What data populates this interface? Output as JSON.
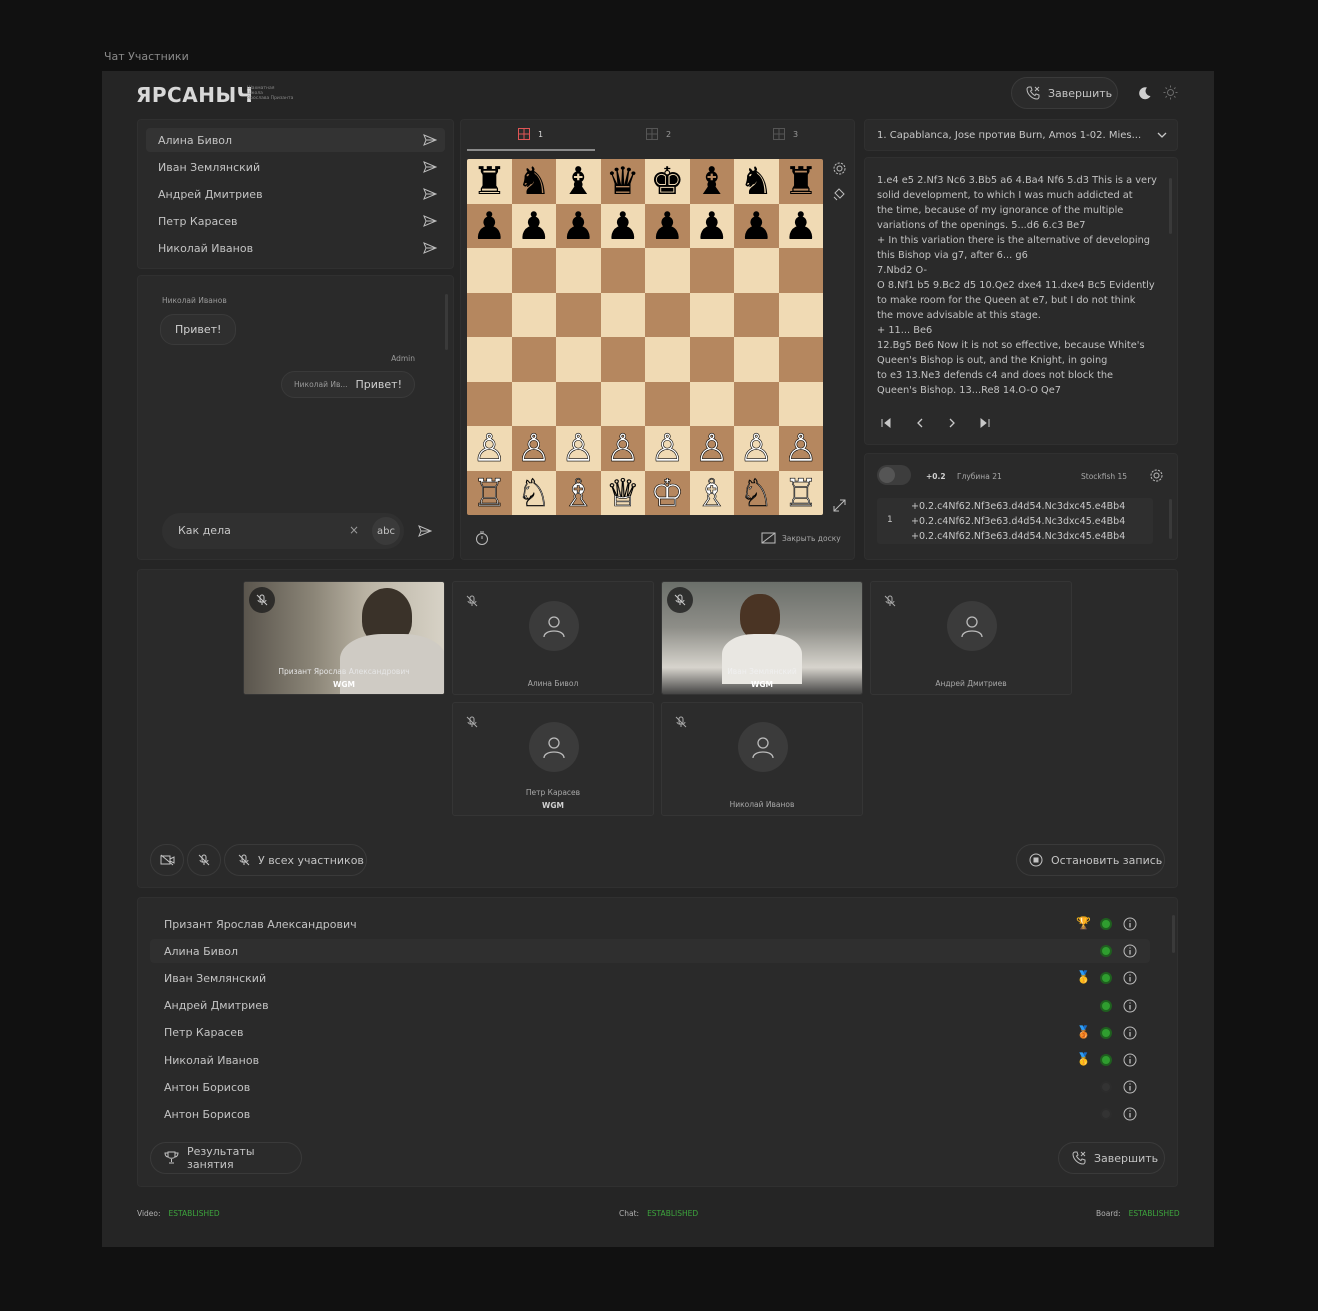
{
  "top_caption": "Чат Участники",
  "header": {
    "logo": "ЯРСАНЫЧ",
    "logo_sub": [
      "Шахматная",
      "Школа",
      "Ярослава Призанта"
    ],
    "end_button": "Завершить"
  },
  "contacts": [
    "Алина Бивол",
    "Иван Землянский",
    "Андрей Дмитриев",
    "Петр Карасев",
    "Николай Иванов"
  ],
  "chat": {
    "messages": [
      {
        "author": "Николай Иванов",
        "text": "Привет!"
      },
      {
        "author": "Admin",
        "quote": "Николай Ив...",
        "text": "Привет!"
      }
    ],
    "input_value": "Как дела",
    "clear_symbol": "×",
    "abc_label": "abc"
  },
  "board_tabs": [
    "1",
    "2",
    "3"
  ],
  "board": {
    "rows": [
      [
        "♜",
        "♞",
        "♝",
        "♛",
        "♚",
        "♝",
        "♞",
        "♜"
      ],
      [
        "♟",
        "♟",
        "♟",
        "♟",
        "♟",
        "♟",
        "♟",
        "♟"
      ],
      [
        "",
        "",
        "",
        "",
        "",
        "",
        "",
        ""
      ],
      [
        "",
        "",
        "",
        "",
        "",
        "",
        "",
        ""
      ],
      [
        "",
        "",
        "",
        "",
        "",
        "",
        "",
        ""
      ],
      [
        "",
        "",
        "",
        "",
        "",
        "",
        "",
        ""
      ],
      [
        "♙",
        "♙",
        "♙",
        "♙",
        "♙",
        "♙",
        "♙",
        "♙"
      ],
      [
        "♖",
        "♘",
        "♗",
        "♕",
        "♔",
        "♗",
        "♘",
        "♖"
      ]
    ],
    "close_label": "Закрыть доску"
  },
  "game": {
    "select_value": "1. Capablanca, Jose против Burn, Amos 1-02. Mies...",
    "notes": "1.e4 e5 2.Nf3 Nc6 3.Bb5 a6 4.Ba4 Nf6 5.d3 This is a very\nsolid development, to which I was much addicted at\nthe time, because of my ignorance of the multiple\nvariations of the openings. 5...d6 6.c3 Be7\n+ In this variation there is the alternative of developing\nthis Bishop via g7, after 6... g6\n7.Nbd2 O-\nO 8.Nf1 b5 9.Bc2 d5 10.Qe2 dxe4 11.dxe4 Bc5 Evidently\nto make room for the Queen at e7, but I do not think\nthe move advisable at this stage.\n+ 11... Be6\n12.Bg5 Be6 Now it is not so effective, because White's\nQueen's Bishop is out, and the Knight, in going\nto e3 13.Ne3 defends c4 and does not block the\nQueen's Bishop. 13...Re8 14.O-O Qe7"
  },
  "engine": {
    "eval": "+0.2",
    "depth": "Глубина 21",
    "name": "Stockfish 15",
    "line_no": "1",
    "lines": [
      "+0.2.c4Nf62.Nf3e63.d4d54.Nc3dxc45.e4Bb4",
      "+0.2.c4Nf62.Nf3e63.d4d54.Nc3dxc45.e4Bb4",
      "+0.2.c4Nf62.Nf3e63.d4d54.Nc3dxc45.e4Bb4"
    ]
  },
  "video_tiles": [
    {
      "name": "Призант Ярослав Александрович",
      "tag": "WGM"
    },
    {
      "name": "Алина Бивол",
      "tag": ""
    },
    {
      "name": "Иван Землянский",
      "tag": "WGM"
    },
    {
      "name": "Андрей Дмитриев",
      "tag": ""
    },
    {
      "name": "Петр Карасев",
      "tag": "WGM"
    },
    {
      "name": "Николай Иванов",
      "tag": ""
    }
  ],
  "controls": {
    "mute_all": "У всех участников",
    "stop_record": "Остановить запись"
  },
  "participants": [
    {
      "name": "Призант Ярослав Александрович",
      "medal": "🏆",
      "online": true
    },
    {
      "name": "Алина Бивол",
      "medal": "",
      "online": true
    },
    {
      "name": "Иван Землянский",
      "medal": "🥇",
      "online": true
    },
    {
      "name": "Андрей Дмитриев",
      "medal": "",
      "online": true
    },
    {
      "name": "Петр Карасев",
      "medal": "🥉",
      "online": true
    },
    {
      "name": "Николай Иванов",
      "medal": "🥇",
      "online": true
    },
    {
      "name": "Антон Борисов",
      "medal": "",
      "online": false
    },
    {
      "name": "Антон Борисов",
      "medal": "",
      "online": false
    }
  ],
  "bottom": {
    "results": "Результаты занятия",
    "end": "Завершить"
  },
  "footer": {
    "video_label": "Video:",
    "video_status": "ESTABLISHED",
    "chat_label": "Chat:",
    "chat_status": "ESTABLISHED",
    "board_label": "Board:",
    "board_status": "ESTABLISHED"
  },
  "colors": {
    "accent_green": "#2f9d2f",
    "tab_active": "#e05555"
  }
}
